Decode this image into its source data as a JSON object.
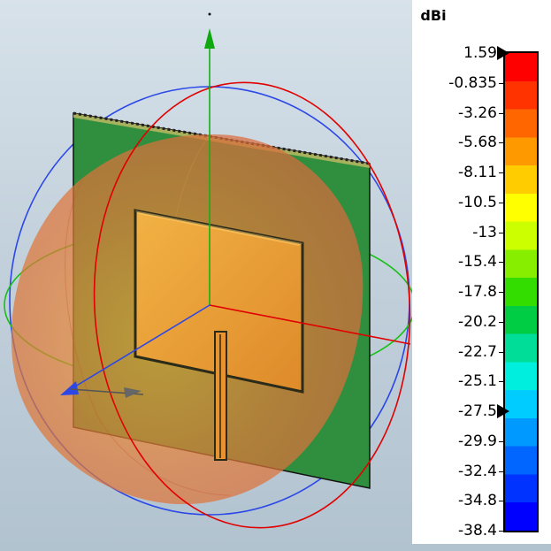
{
  "legend": {
    "unit": "dBi",
    "ticks": [
      "1.59",
      "-0.835",
      "-3.26",
      "-5.68",
      "-8.11",
      "-10.5",
      "-13",
      "-15.4",
      "-17.8",
      "-20.2",
      "-22.7",
      "-25.1",
      "-27.5",
      "-29.9",
      "-32.4",
      "-34.8",
      "-38.4"
    ],
    "marker_values": [
      "1.59",
      "-27.5"
    ],
    "colormap": [
      "#ff0000",
      "#ff3300",
      "#ff6600",
      "#ff9900",
      "#ffcc00",
      "#ffff00",
      "#ccff00",
      "#88ee00",
      "#33dd00",
      "#00cc44",
      "#00dd99",
      "#00eedd",
      "#00ccff",
      "#0099ff",
      "#0066ff",
      "#0033ff",
      "#0000ff"
    ]
  },
  "scene": {
    "background_color": "#c8d6e0",
    "substrate_color": "#2f8f3f",
    "patch_color": "#e69a2e",
    "pattern_color": "#e06a30",
    "axis_colors": {
      "x": "#e00000",
      "y": "#00c000",
      "z": "#1d3fe0"
    }
  }
}
